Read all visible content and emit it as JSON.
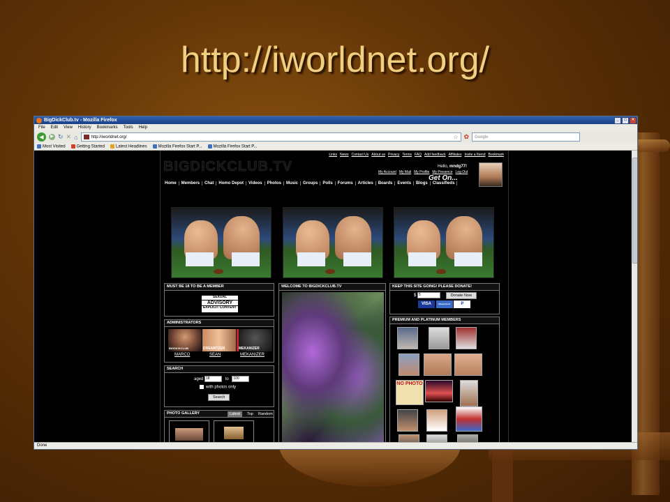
{
  "slide": {
    "title": "http://iworldnet.org/"
  },
  "browser": {
    "window_title": "BigDickClub.tv - Mozilla Firefox",
    "menus": [
      "File",
      "Edit",
      "View",
      "History",
      "Bookmarks",
      "Tools",
      "Help"
    ],
    "url": "http://iworldnet.org/",
    "search_placeholder": "Google",
    "bookmarks": [
      "Most Visited",
      "Getting Started",
      "Latest Headlines",
      "Mozilla Firefox Start P...",
      "Mozilla Firefox Start P..."
    ],
    "status": "Done"
  },
  "site": {
    "logo": "BIGDICKCLUB.TV",
    "top_links": [
      "Links",
      "News",
      "Contact Us",
      "About us",
      "Privacy",
      "Terms",
      "FAQ",
      "Add feedback",
      "Affiliates",
      "Invite a friend",
      "Bookmark"
    ],
    "greeting_prefix": "Hello,",
    "username": "mndg77!",
    "account_links": [
      "My Account",
      "My Mail",
      "My Profile",
      "My Presence",
      "Log Out"
    ],
    "tagline": "Get On...",
    "nav": [
      "Home",
      "Members",
      "Chat",
      "Homo Depot",
      "Videos",
      "Photos",
      "Music",
      "Groups",
      "Polls",
      "Forums",
      "Articles",
      "Boards",
      "Events",
      "Blogs",
      "Classifieds"
    ],
    "must_be_18": {
      "title": "MUST BE 18 TO BE A MEMBER",
      "advisory_top": "SEXUAL",
      "advisory_mid": "ADVISORY",
      "advisory_bottom": "EXPLICIT CONTENT"
    },
    "administrators": {
      "title": "ADMINISTRATORS",
      "badges": [
        "BIGDICKCLUB",
        "DREAMTZER",
        "MEKANIZER"
      ],
      "names": [
        "MARCO",
        "SEAN",
        "MEKANIZER"
      ]
    },
    "search": {
      "title": "SEARCH",
      "aged_label": "aged",
      "from": "18",
      "to_label": "to",
      "to": "100",
      "photos_label": "with photos only",
      "button": "Search"
    },
    "photo_gallery": {
      "title": "PHOTO GALLERY",
      "tabs": [
        "Latest",
        "Top",
        "Random"
      ]
    },
    "welcome": {
      "title": "WELCOME TO BIGDICKCLUB.TV"
    },
    "donate": {
      "title": "KEEP THIS SITE GOING! PLEASE DONATE!",
      "currency": "$",
      "amount": "5",
      "button": "Donate Now",
      "cards": [
        "VISA",
        "MasterCard",
        "P"
      ]
    },
    "premium": {
      "title": "PREMIUM AND PLATINUM MEMBERS",
      "no_photo_label": "NO PHOTO"
    }
  },
  "colors": {
    "slide_title": "#f0d080",
    "site_bg": "#000000",
    "accent_border": "#777777"
  }
}
